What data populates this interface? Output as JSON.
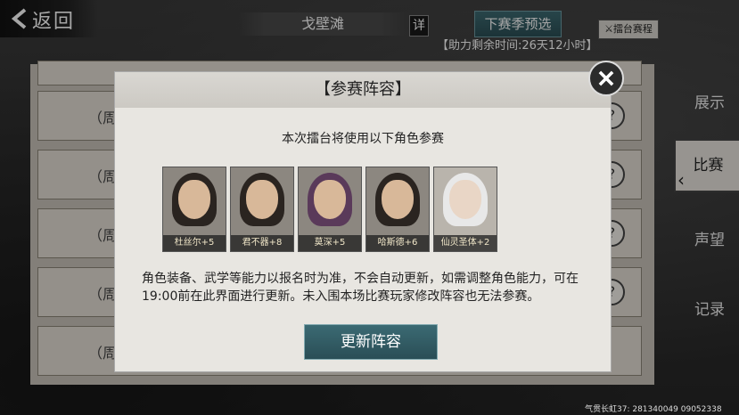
{
  "header": {
    "back_label": "返回",
    "title": "戈壁滩",
    "detail_label": "详",
    "next_season_label": "下赛季预选",
    "schedule_label": "擂台赛程",
    "help_time": "【助力剩余时间:26天12小时】"
  },
  "list": {
    "rows": [
      {
        "label": "（周I"
      },
      {
        "label": "（周I"
      },
      {
        "label": "（周I"
      },
      {
        "label": "（周I"
      },
      {
        "label": "（周"
      }
    ],
    "help_glyph": "?"
  },
  "side_tabs": [
    {
      "label": "展示",
      "active": false
    },
    {
      "label": "比赛",
      "active": true
    },
    {
      "label": "声望",
      "active": false
    },
    {
      "label": "记录",
      "active": false
    }
  ],
  "modal": {
    "title": "【参赛阵容】",
    "subtitle": "本次擂台将使用以下角色参赛",
    "characters": [
      {
        "name": "杜丝尔+5"
      },
      {
        "name": "君不器+8"
      },
      {
        "name": "莫深+5"
      },
      {
        "name": "哈斯德+6"
      },
      {
        "name": "仙灵圣体+2"
      }
    ],
    "description": "角色装备、武学等能力以报名时为准，不会自动更新，如需调整角色能力，可在19:00前在此界面进行更新。未入围本场比赛玩家修改阵容也无法参赛。",
    "update_label": "更新阵容"
  },
  "footer": {
    "info": "气贯长虹37: 281340049 09052338"
  },
  "colors": {
    "accent": "#2f5a62",
    "panel": "#e8e6e1"
  }
}
